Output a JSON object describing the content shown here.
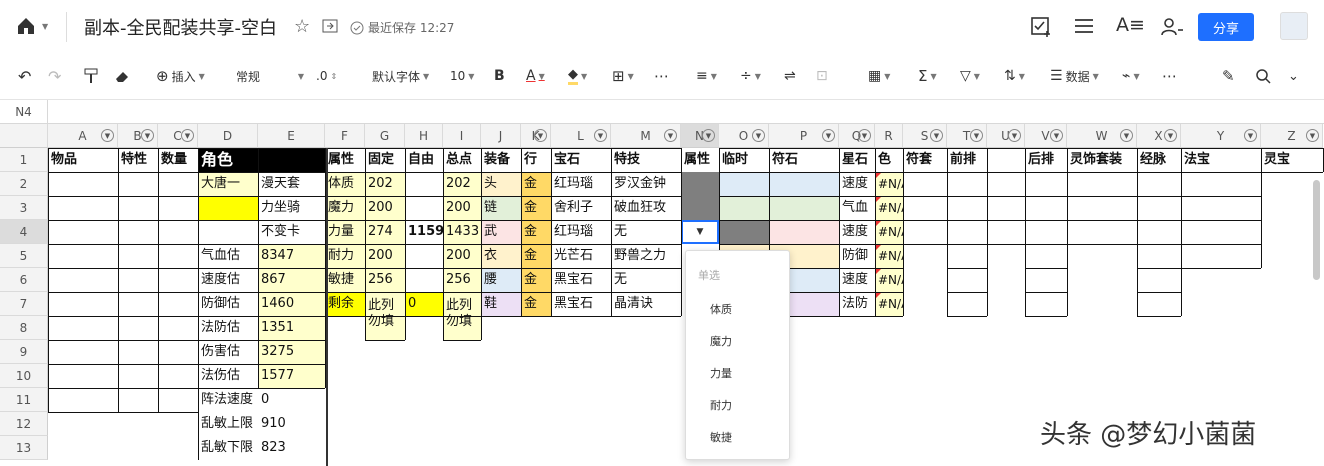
{
  "title": "副本-全民配装共享-空白",
  "save_status": "最近保存 12:27",
  "share": "分享",
  "toolbar": {
    "insert": "插入",
    "format": "常规",
    "decimal": ".0",
    "font": "默认字体",
    "size": "10",
    "bold": "B",
    "color_a": "A",
    "data": "数据"
  },
  "cell_ref": "N4",
  "columns": [
    {
      "l": "A",
      "w": 70,
      "f": 1
    },
    {
      "l": "B",
      "w": 40,
      "f": 1
    },
    {
      "l": "C",
      "w": 40,
      "f": 1
    },
    {
      "l": "D",
      "w": 60,
      "f": 0
    },
    {
      "l": "E",
      "w": 67,
      "f": 0
    },
    {
      "l": "F",
      "w": 40,
      "f": 0
    },
    {
      "l": "G",
      "w": 40,
      "f": 0
    },
    {
      "l": "H",
      "w": 38,
      "f": 0
    },
    {
      "l": "I",
      "w": 38,
      "f": 0
    },
    {
      "l": "J",
      "w": 40,
      "f": 0
    },
    {
      "l": "K",
      "w": 30,
      "f": 1
    },
    {
      "l": "L",
      "w": 60,
      "f": 1
    },
    {
      "l": "M",
      "w": 70,
      "f": 1
    },
    {
      "l": "N",
      "w": 38,
      "f": 1
    },
    {
      "l": "O",
      "w": 50,
      "f": 1
    },
    {
      "l": "P",
      "w": 70,
      "f": 1
    },
    {
      "l": "Q",
      "w": 36,
      "f": 1
    },
    {
      "l": "R",
      "w": 28,
      "f": 0
    },
    {
      "l": "S",
      "w": 44,
      "f": 1
    },
    {
      "l": "T",
      "w": 40,
      "f": 1
    },
    {
      "l": "U",
      "w": 38,
      "f": 1
    },
    {
      "l": "V",
      "w": 42,
      "f": 1
    },
    {
      "l": "W",
      "w": 70,
      "f": 1
    },
    {
      "l": "X",
      "w": 44,
      "f": 1
    },
    {
      "l": "Y",
      "w": 80,
      "f": 1
    },
    {
      "l": "Z",
      "w": 62,
      "f": 1
    }
  ],
  "rows": [
    "1",
    "2",
    "3",
    "4",
    "5",
    "6",
    "7",
    "8",
    "9",
    "10",
    "11",
    "12",
    "13"
  ],
  "header_row": [
    "物品",
    "特性",
    "数量",
    "角色",
    "",
    "属性",
    "固定",
    "自由",
    "总点",
    "装备",
    "行",
    "宝石",
    "特技",
    "属性",
    "临时",
    "符石",
    "星石",
    "色",
    "符套",
    "前排",
    "",
    "后排",
    "灵饰套装",
    "经脉",
    "法宝",
    "灵宝"
  ],
  "cells": {
    "D2": "大唐一",
    "E2": "漫天套",
    "E3": "力坐骑",
    "E4": "不变卡",
    "D5": "气血估",
    "E5": "8347",
    "D6": "速度估",
    "E6": "867",
    "D7": "防御估",
    "E7": "1460",
    "D8": "法防估",
    "E8": "1351",
    "D9": "伤害估",
    "E9": "3275",
    "D10": "法伤估",
    "E10": "1577",
    "D11": "阵法速度",
    "E11": "0",
    "D12": "乱敏上限",
    "E12": "910",
    "D13": "乱敏下限",
    "E13": "823",
    "F2": "体质",
    "G2": "202",
    "I2": "202",
    "J2": "头",
    "K2": "金",
    "L2": "红玛瑙",
    "M2": "罗汉金钟",
    "Q2": "速度",
    "R2": "#N/A",
    "F3": "魔力",
    "G3": "200",
    "I3": "200",
    "J3": "链",
    "K3": "金",
    "L3": "舍利子",
    "M3": "破血狂攻",
    "Q3": "气血",
    "R3": "#N/A",
    "F4": "力量",
    "G4": "274",
    "H4": "1159",
    "I4": "1433",
    "J4": "武",
    "K4": "金",
    "L4": "红玛瑙",
    "M4": "无",
    "Q4": "速度",
    "R4": "#N/A",
    "F5": "耐力",
    "G5": "200",
    "I5": "200",
    "J5": "衣",
    "K5": "金",
    "L5": "光芒石",
    "M5": "野兽之力",
    "Q5": "防御",
    "R5": "#N/A",
    "F6": "敏捷",
    "G6": "256",
    "I6": "256",
    "J6": "腰",
    "K6": "金",
    "L6": "黑宝石",
    "M6": "无",
    "Q6": "速度",
    "R6": "#N/A",
    "F7": "剩余",
    "G7": "此列 勿填",
    "H7": "0",
    "I7": "此列 勿填",
    "J7": "鞋",
    "K7": "金",
    "L7": "黑宝石",
    "M7": "晶清诀",
    "Q7": "法防",
    "R7": "#N/A"
  },
  "dropdown": {
    "header": "单选",
    "options": [
      "体质",
      "魔力",
      "力量",
      "耐力",
      "敏捷"
    ]
  },
  "watermark": "头条 @梦幻小菌菌",
  "colors": {
    "yellow": "#ffffcc",
    "bright_yellow": "#ffff00",
    "gold": "#ffd966",
    "accent": "#1e6fff",
    "selected_dark": "#7f7f7f"
  }
}
